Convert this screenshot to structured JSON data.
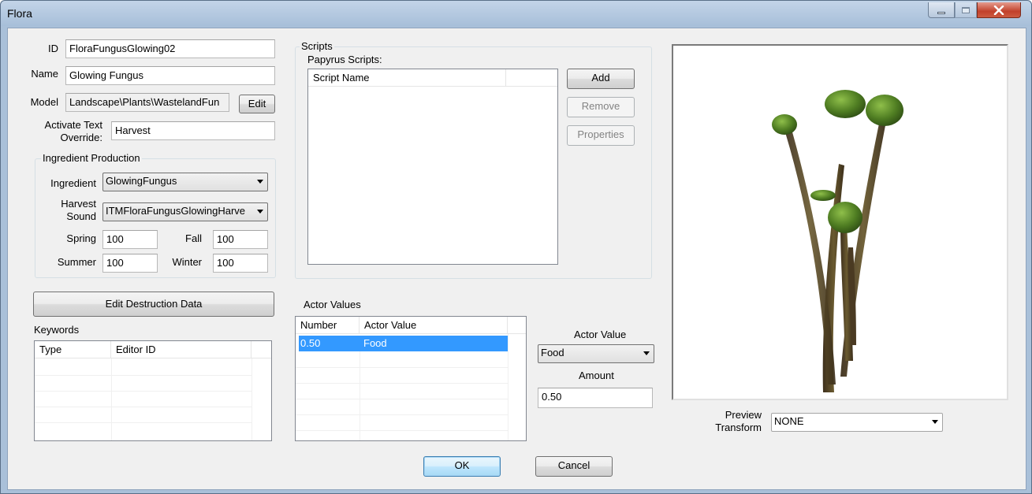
{
  "window": {
    "title": "Flora"
  },
  "form": {
    "id_label": "ID",
    "id_value": "FloraFungusGlowing02",
    "name_label": "Name",
    "name_value": "Glowing Fungus",
    "model_label": "Model",
    "model_value": "Landscape\\Plants\\WastelandFun",
    "edit_button": "Edit",
    "activate_label_line1": "Activate Text",
    "activate_label_line2": "Override:",
    "activate_value": "Harvest"
  },
  "ingredient_production": {
    "title": "Ingredient Production",
    "ingredient_label": "Ingredient",
    "ingredient_value": "GlowingFungus",
    "harvest_label_line1": "Harvest",
    "harvest_label_line2": "Sound",
    "harvest_value": "ITMFloraFungusGlowingHarve",
    "spring_label": "Spring",
    "spring_value": "100",
    "fall_label": "Fall",
    "fall_value": "100",
    "summer_label": "Summer",
    "summer_value": "100",
    "winter_label": "Winter",
    "winter_value": "100"
  },
  "destruction_button": "Edit Destruction Data",
  "keywords": {
    "title": "Keywords",
    "columns": [
      "Type",
      "Editor ID"
    ]
  },
  "scripts": {
    "group_title": "Scripts",
    "subtitle": "Papyrus Scripts:",
    "column": "Script Name",
    "add_button": "Add",
    "remove_button": "Remove",
    "properties_button": "Properties"
  },
  "actor_values": {
    "title": "Actor Values",
    "columns": [
      "Number",
      "Actor Value"
    ],
    "rows": [
      {
        "number": "0.50",
        "actor_value": "Food",
        "selected": true
      }
    ],
    "actor_value_label": "Actor Value",
    "actor_value_selected": "Food",
    "amount_label": "Amount",
    "amount_value": "0.50"
  },
  "preview": {
    "transform_label_line1": "Preview",
    "transform_label_line2": "Transform",
    "transform_value": "NONE"
  },
  "buttons": {
    "ok": "OK",
    "cancel": "Cancel"
  },
  "colors": {
    "selection": "#3399ff",
    "fungus_cap": "#5a8a2a",
    "fungus_stem": "#4a3a22"
  }
}
